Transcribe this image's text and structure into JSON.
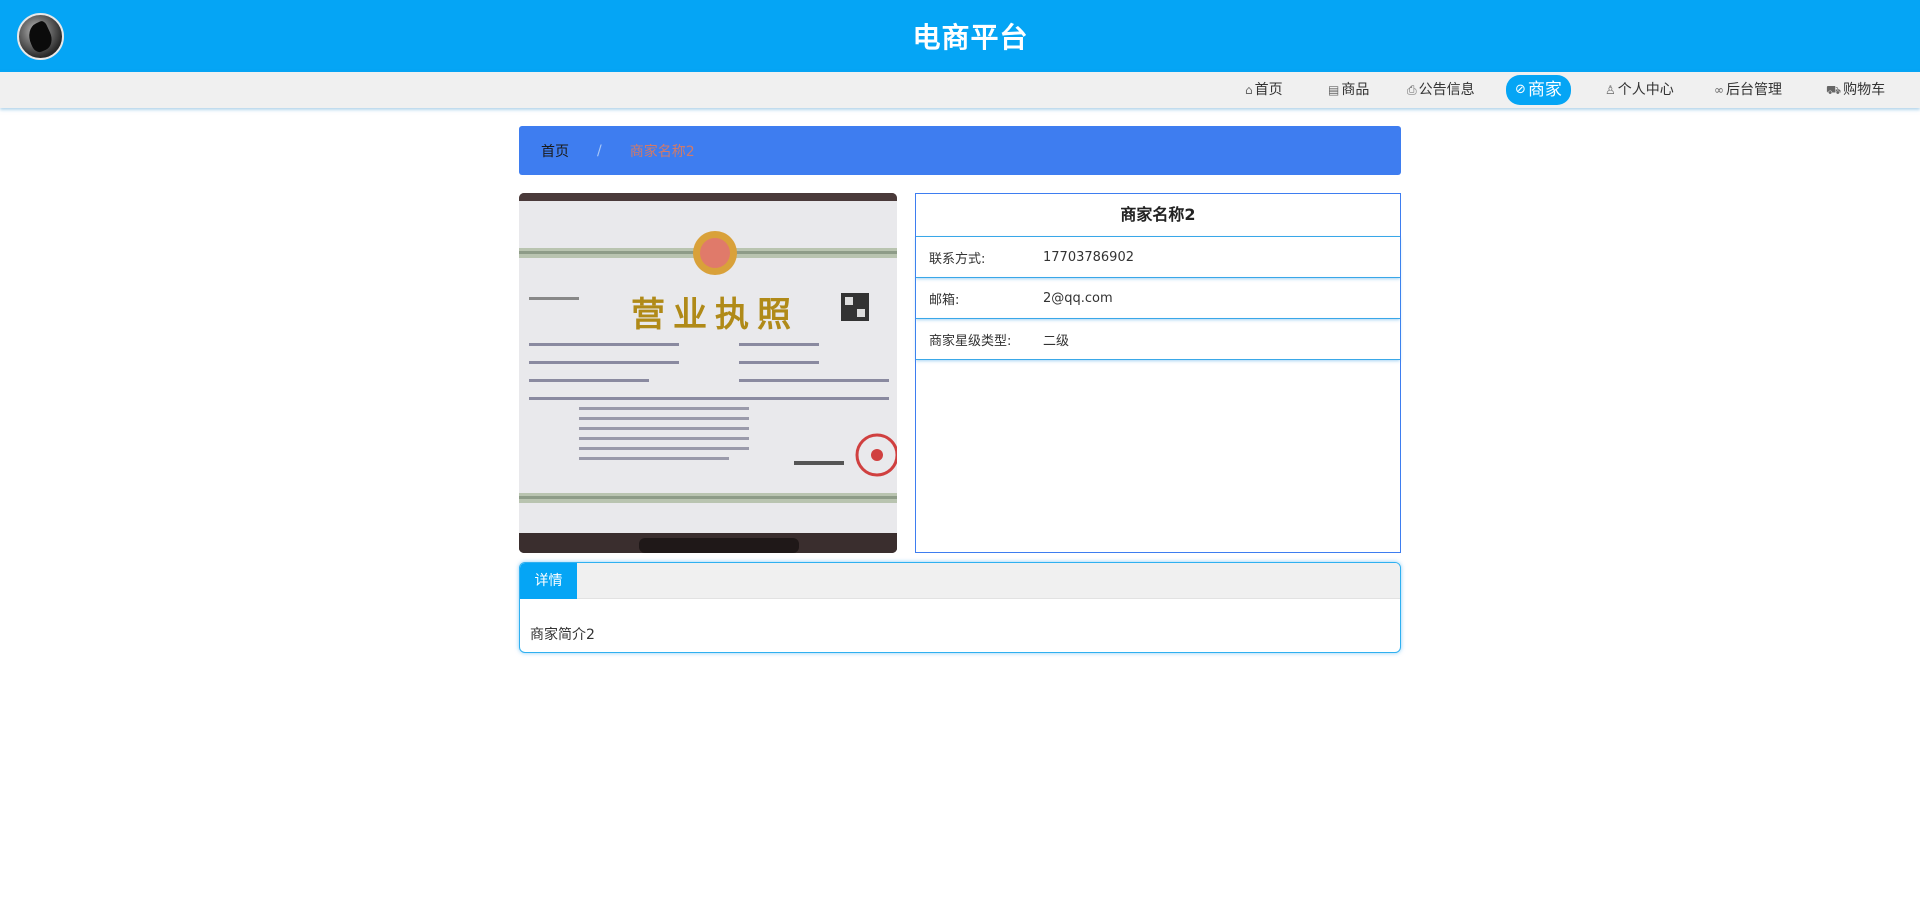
{
  "header": {
    "title": "电商平台"
  },
  "nav": {
    "items": [
      {
        "label": "首页",
        "icon": "home-icon"
      },
      {
        "label": "商品",
        "icon": "document-icon"
      },
      {
        "label": "公告信息",
        "icon": "printer-icon"
      },
      {
        "label": "商家",
        "icon": "link-icon",
        "active": true
      },
      {
        "label": "个人中心",
        "icon": "user-icon"
      },
      {
        "label": "后台管理",
        "icon": "link-icon"
      },
      {
        "label": "购物车",
        "icon": "cart-icon"
      }
    ]
  },
  "breadcrumb": {
    "home": "首页",
    "separator": "/",
    "current": "商家名称2"
  },
  "merchant": {
    "name": "商家名称2",
    "rows": [
      {
        "label": "联系方式:",
        "value": "17703786902"
      },
      {
        "label": "邮箱:",
        "value": "2@qq.com"
      },
      {
        "label": "商家星级类型:",
        "value": "二级"
      }
    ]
  },
  "license_image": {
    "heading": "营业执照"
  },
  "tabs": {
    "active_label": "详情",
    "content": "商家简介2"
  },
  "colors": {
    "brand": "#05a5f5",
    "breadcrumb": "#3e7df0"
  }
}
